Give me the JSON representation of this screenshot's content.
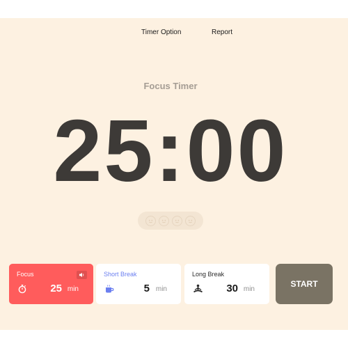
{
  "nav": {
    "timer_option": "Timer Option",
    "report": "Report"
  },
  "timer": {
    "title": "Focus Timer",
    "time": "25:00"
  },
  "sessions": {
    "count": 4,
    "completed": 0
  },
  "modes": [
    {
      "label": "Focus",
      "value": "25",
      "unit": "min",
      "icon": "stopwatch-icon",
      "active": true,
      "sound_icon": "speaker-icon"
    },
    {
      "label": "Short Break",
      "value": "5",
      "unit": "min",
      "icon": "coffee-cup-icon",
      "active": false
    },
    {
      "label": "Long Break",
      "value": "30",
      "unit": "min",
      "icon": "meditation-icon",
      "active": false
    }
  ],
  "start_button": {
    "label": "START"
  },
  "colors": {
    "background": "#fdf1e1",
    "focus_accent": "#ff5c5c",
    "short_break_accent": "#6b7ff0",
    "start_button": "#7a7364",
    "clock_text": "#3d3a37"
  }
}
